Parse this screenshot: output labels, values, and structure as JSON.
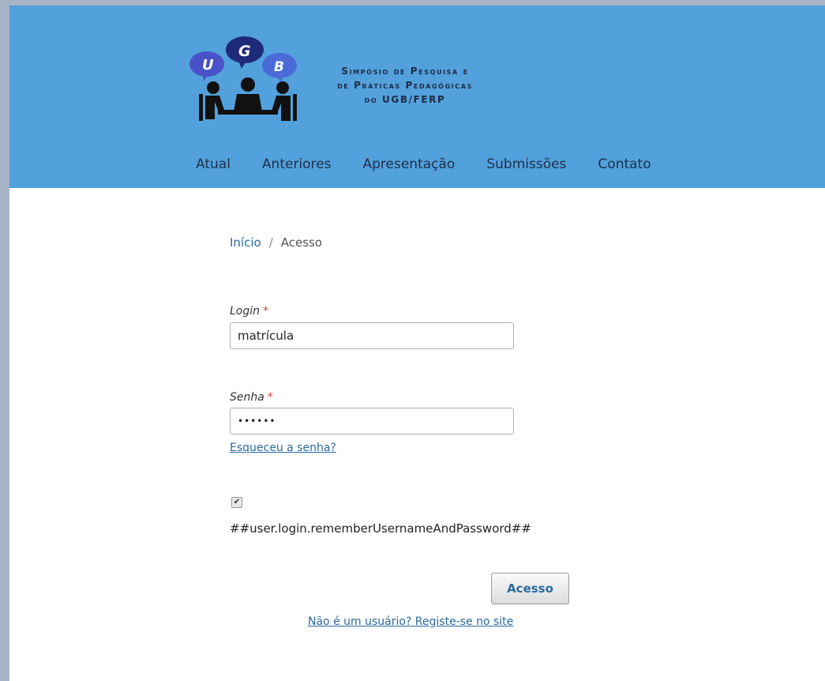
{
  "header": {
    "logo": {
      "bubbles": [
        "U",
        "G",
        "B"
      ],
      "title_lines": [
        "Simpósio de Pesquisa e",
        "de Práticas Pedagógicas",
        "do UGB/FERP"
      ]
    },
    "nav": [
      "Atual",
      "Anteriores",
      "Apresentação",
      "Submissões",
      "Contato"
    ]
  },
  "breadcrumb": {
    "home": "Início",
    "separator": "/",
    "current": "Acesso"
  },
  "form": {
    "login_label": "Login",
    "login_value": "matrícula",
    "password_label": "Senha",
    "password_value": "••••••",
    "required_mark": "*",
    "forgot_link": "Esqueceu a senha?",
    "remember_checked": true,
    "remember_label": "##user.login.rememberUsernameAndPassword##",
    "submit_label": "Acesso",
    "register_link": "Não é um usuário? Registe-se no site"
  },
  "colors": {
    "header_bg": "#52a1dc",
    "link": "#2b6aa0",
    "required": "#d0453c"
  }
}
